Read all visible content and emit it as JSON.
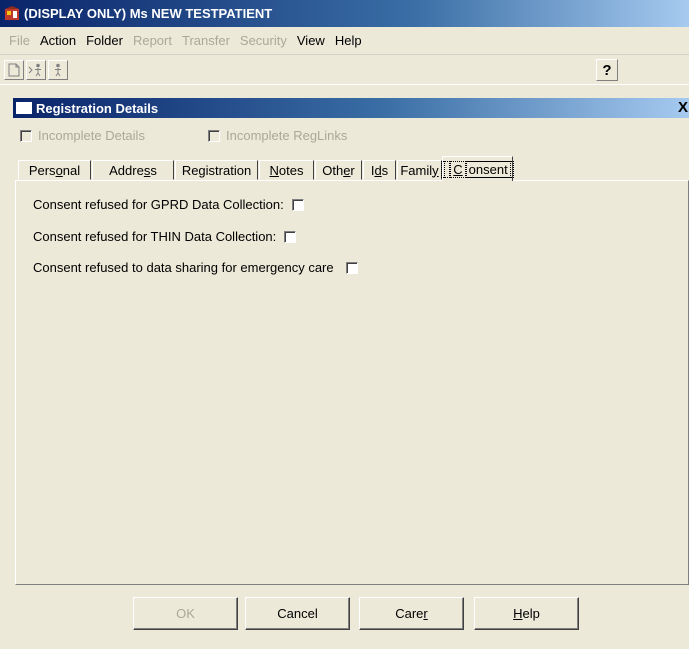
{
  "window": {
    "title": "(DISPLAY ONLY) Ms NEW TESTPATIENT"
  },
  "menu": [
    {
      "label": "File",
      "disabled": true
    },
    {
      "label": "Action",
      "disabled": false
    },
    {
      "label": "Folder",
      "disabled": false
    },
    {
      "label": "Report",
      "disabled": true
    },
    {
      "label": "Transfer",
      "disabled": true
    },
    {
      "label": "Security",
      "disabled": true
    },
    {
      "label": "View",
      "disabled": false
    },
    {
      "label": "Help",
      "disabled": false
    }
  ],
  "toolbar": {
    "icons": [
      "new-document-icon",
      "transfer-person-icon",
      "person-icon",
      "help-icon"
    ],
    "help_glyph": "?"
  },
  "dialog": {
    "title": "Registration Details",
    "close_glyph": "X",
    "incomplete_details": "Incomplete Details",
    "incomplete_reglinks": "Incomplete RegLinks"
  },
  "tabs": [
    {
      "pre": "Pers",
      "u": "o",
      "post": "nal"
    },
    {
      "pre": "Addre",
      "u": "s",
      "post": "s"
    },
    {
      "pre": "Registration",
      "u": "",
      "post": ""
    },
    {
      "pre": "",
      "u": "N",
      "post": "otes"
    },
    {
      "pre": "Oth",
      "u": "e",
      "post": "r"
    },
    {
      "pre": "I",
      "u": "d",
      "post": "s"
    },
    {
      "pre": "Famil",
      "u": "y",
      "post": ""
    },
    {
      "pre": "",
      "u": "C",
      "post": "onsent"
    }
  ],
  "active_tab": 7,
  "consent": {
    "gprd": "Consent refused for GPRD Data Collection:",
    "thin": "Consent refused for THIN Data Collection:",
    "emergency": "Consent refused to data sharing for emergency care"
  },
  "buttons": {
    "ok": "OK",
    "cancel": "Cancel",
    "carer_pre": "Care",
    "carer_u": "r",
    "help_u": "H",
    "help_post": "elp"
  },
  "colors": {
    "titlebar_start": "#0a246a",
    "titlebar_end": "#a6caf0",
    "face": "#ece9d8",
    "disabled_text": "#aca899"
  }
}
